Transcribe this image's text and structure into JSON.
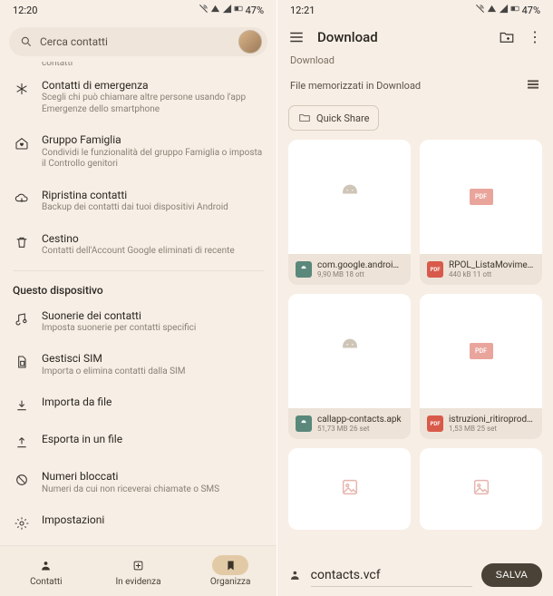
{
  "left": {
    "status": {
      "time": "12:20",
      "battery": "47%"
    },
    "search": {
      "placeholder": "Cerca contatti"
    },
    "fragment_sub": "contatti",
    "items": [
      {
        "icon": "asterisk",
        "title": "Contatti di emergenza",
        "sub": "Scegli chi può chiamare altre persone usando l'app Emergenze dello smartphone"
      },
      {
        "icon": "home-heart",
        "title": "Gruppo Famiglia",
        "sub": "Condividi le funzionalità del gruppo Famiglia o imposta il Controllo genitori"
      },
      {
        "icon": "cloud-down",
        "title": "Ripristina contatti",
        "sub": "Backup dei contatti dai tuoi dispositivi Android"
      },
      {
        "icon": "trash",
        "title": "Cestino",
        "sub": "Contatti dell'Account Google eliminati di recente"
      }
    ],
    "section": "Questo dispositivo",
    "items2": [
      {
        "icon": "music-note",
        "title": "Suonerie dei contatti",
        "sub": "Imposta suonerie per contatti specifici"
      },
      {
        "icon": "sim",
        "title": "Gestisci SIM",
        "sub": "Importa o elimina contatti dalla SIM"
      },
      {
        "icon": "download",
        "title": "Importa da file",
        "sub": ""
      },
      {
        "icon": "upload",
        "title": "Esporta in un file",
        "sub": ""
      },
      {
        "icon": "block",
        "title": "Numeri bloccati",
        "sub": "Numeri da cui non riceverai chiamate o SMS"
      },
      {
        "icon": "gear",
        "title": "Impostazioni",
        "sub": ""
      }
    ],
    "nav": {
      "contacts": "Contatti",
      "highlights": "In evidenza",
      "organize": "Organizza"
    }
  },
  "right": {
    "status": {
      "time": "12:21",
      "battery": "47%"
    },
    "title": "Download",
    "breadcrumb": "Download",
    "subheader": "File memorizzati in Download",
    "chip": "Quick Share",
    "files": [
      {
        "type": "apk",
        "name": "com.google.androi…",
        "detail": "9,90 MB 18 ott"
      },
      {
        "type": "pdf",
        "name": "RPOL_ListaMovime…",
        "detail": "440 kB 11 ott"
      },
      {
        "type": "apk",
        "name": "callapp-contacts.apk",
        "detail": "51,73 MB 26 set"
      },
      {
        "type": "pdf",
        "name": "istruzioni_ritiroprod…",
        "detail": "1,53 MB 25 set"
      }
    ],
    "filename": "contacts.vcf",
    "save": "SALVA"
  }
}
